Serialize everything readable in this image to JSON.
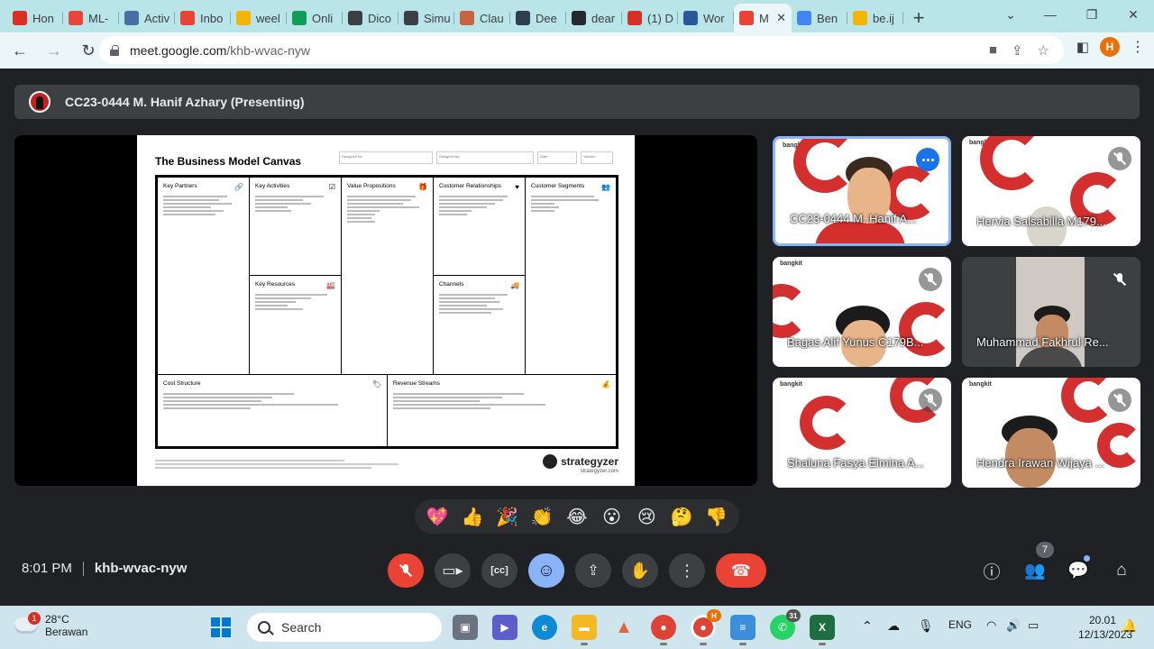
{
  "browser": {
    "tabs": [
      {
        "label": "Hon",
        "color": "#d93025",
        "icon": "star-icon"
      },
      {
        "label": "ML-",
        "color": "#e8453c",
        "icon": "target-icon"
      },
      {
        "label": "Activ",
        "color": "#4a6fa5",
        "icon": "activity-icon"
      },
      {
        "label": "Inbo",
        "color": "#ea4335",
        "icon": "gmail-icon"
      },
      {
        "label": "weel",
        "color": "#f4b400",
        "icon": "slides-icon"
      },
      {
        "label": "Onli",
        "color": "#0f9d58",
        "icon": "classroom-icon"
      },
      {
        "label": "Dico",
        "color": "#3c4043",
        "icon": "dicoding-icon"
      },
      {
        "label": "Simu",
        "color": "#3c4043",
        "icon": "dicoding-icon"
      },
      {
        "label": "Clau",
        "color": "#c96442",
        "icon": "claude-icon"
      },
      {
        "label": "Dee",
        "color": "#2d3e50",
        "icon": "deepl-icon"
      },
      {
        "label": "dear",
        "color": "#24292e",
        "icon": "github-icon"
      },
      {
        "label": "(1) D",
        "color": "#d93025",
        "icon": "notification-icon"
      },
      {
        "label": "Wor",
        "color": "#2b579a",
        "icon": "docs-icon"
      },
      {
        "label": "M",
        "color": "#ea4335",
        "icon": "meet-record-icon"
      },
      {
        "label": "Ben",
        "color": "#4285f4",
        "icon": "docs-icon"
      },
      {
        "label": "be.ij",
        "color": "#f4b400",
        "icon": "folder-icon"
      }
    ],
    "active_tab_index": 13,
    "close_glyph": "✕",
    "new_tab_glyph": "+",
    "url_host": "meet.google.com",
    "url_path": "/khb-wvac-nyw",
    "profile_initial": "H"
  },
  "meet": {
    "presenter_bar": "CC23-0444 M. Hanif Azhary (Presenting)",
    "slide": {
      "title": "The Business Model Canvas",
      "meta": [
        "Designed for:",
        "Designed by:",
        "Date:",
        "Version:"
      ],
      "blocks": {
        "key_partners": "Key Partners",
        "key_activities": "Key Activities",
        "value_propositions": "Value Propositions",
        "customer_relationships": "Customer Relationships",
        "customer_segments": "Customer Segments",
        "key_resources": "Key Resources",
        "channels": "Channels",
        "cost_structure": "Cost Structure",
        "revenue_streams": "Revenue Streams"
      },
      "brand": "strategyzer",
      "brand_url": "strategyzer.com"
    },
    "participants": [
      {
        "name": "CC23-0444 M. Hanif A...",
        "speaking": true,
        "muted": false
      },
      {
        "name": "Hervia Salsabilla M179...",
        "speaking": false,
        "muted": true
      },
      {
        "name": "Bagas Alif Yunus C179B...",
        "speaking": false,
        "muted": true
      },
      {
        "name": "Muhammad Fakhrul Re...",
        "speaking": false,
        "muted": true
      },
      {
        "name": "Shaluna Fasya Elmina A...",
        "speaking": false,
        "muted": true
      },
      {
        "name": "Hendra Irawan Wijaya ...",
        "speaking": false,
        "muted": true
      }
    ],
    "tile_brand": "bangkit",
    "reactions": [
      "💖",
      "👍",
      "🎉",
      "👏",
      "😂",
      "😮",
      "😢",
      "🤔",
      "👎"
    ],
    "time": "8:01 PM",
    "meeting_code": "khb-wvac-nyw",
    "people_count": "7",
    "colors": {
      "end_call": "#ea4335",
      "accent": "#8ab4f8",
      "canvas_red": "#d32f2f"
    }
  },
  "taskbar": {
    "weather_temp": "28°C",
    "weather_desc": "Berawan",
    "weather_badge": "1",
    "search_placeholder": "Search",
    "whatsapp_badge": "31",
    "chrome_profile_badge": "H",
    "language": "ENG",
    "clock_time": "20.01",
    "clock_date": "12/13/2023"
  }
}
